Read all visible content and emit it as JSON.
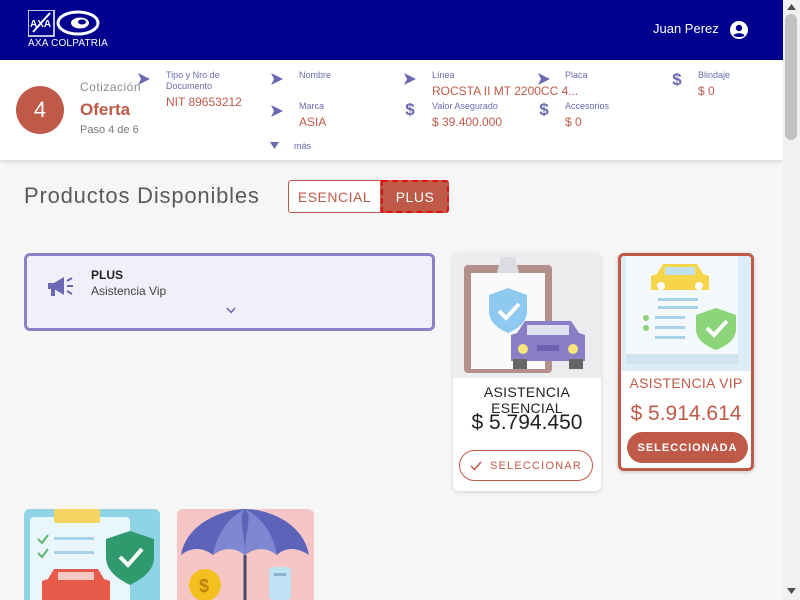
{
  "header": {
    "brand": "AXA COLPATRIA",
    "user_name": "Juan Perez"
  },
  "summary": {
    "step_number": "4",
    "label": "Cotización",
    "title": "Oferta",
    "step_text": "Paso 4 de 6",
    "fields": {
      "documento": {
        "label_line1": "Tipo y Nro de",
        "label_line2": "Documento",
        "value": "NIT 89653212"
      },
      "nombre": {
        "label": "Nombre",
        "value": ""
      },
      "linea": {
        "label": "Línea",
        "value": "ROCSTA II MT 2200CC 4..."
      },
      "placa": {
        "label": "Placa",
        "value": ""
      },
      "blindaje": {
        "label": "Blindaje",
        "value": "$ 0"
      },
      "marca": {
        "label": "Marca",
        "value": "ASIA"
      },
      "valor_asegurado": {
        "label": "Valor Asegurado",
        "value": "$ 39.400.000"
      },
      "accesorios": {
        "label": "Accesorios",
        "value": "$ 0"
      }
    },
    "more_label": "más"
  },
  "products": {
    "title": "Productos Disponibles",
    "toggle": {
      "esencial": "ESENCIAL",
      "plus": "PLUS",
      "selected": "PLUS"
    }
  },
  "plan_panel": {
    "name": "PLUS",
    "description": "Asistencia Vip"
  },
  "cards": [
    {
      "name": "ASISTENCIA ESENCIAL",
      "price": "$ 5.794.450",
      "button": "SELECCIONAR",
      "selected": false
    },
    {
      "name": "ASISTENCIA VIP",
      "price": "$ 5.914.614",
      "button": "SELECCIONADA",
      "selected": true
    }
  ],
  "colors": {
    "header_bg": "#00008f",
    "accent": "#c05a48",
    "label_purple": "#6a6ab4",
    "panel_border": "#8a82c8"
  },
  "icons": [
    "axa-logo",
    "colpatria-logo",
    "user-icon",
    "arrow-right-icon",
    "dollar-icon",
    "chevron-down-icon",
    "megaphone-icon",
    "check-icon"
  ]
}
